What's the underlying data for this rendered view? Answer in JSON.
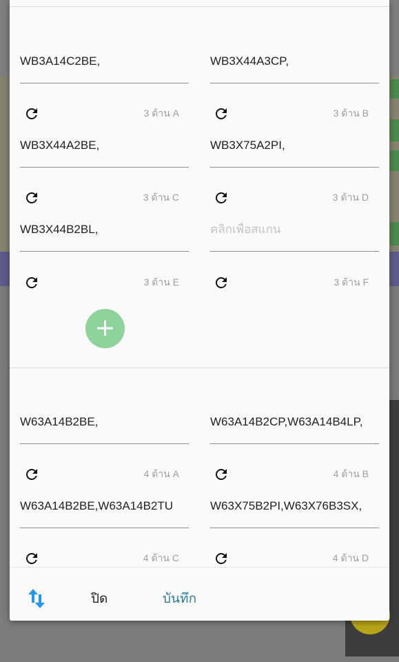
{
  "colors": {
    "accent": "#2196f3",
    "save": "#2e7d9a",
    "fab": "#8ed39c",
    "divider": "#d8d8d8"
  },
  "groups": [
    {
      "fields": [
        {
          "value": "WB3A14C2BE,",
          "label": "3 ด้าน A"
        },
        {
          "value": "WB3X44A3CP,",
          "label": "3 ด้าน B"
        },
        {
          "value": "WB3X44A2BE,",
          "label": "3 ด้าน C"
        },
        {
          "value": "WB3X75A2PI,",
          "label": "3 ด้าน D"
        },
        {
          "value": "WB3X44B2BL,",
          "label": "3 ด้าน E"
        },
        {
          "value": "",
          "placeholder": "คลิกเพื่อสแกน",
          "label": "3 ด้าน F"
        }
      ]
    },
    {
      "fields": [
        {
          "value": "W63A14B2BE,",
          "label": "4 ด้าน A"
        },
        {
          "value": "W63A14B2CP,W63A14B4LP,",
          "label": "4 ด้าน B"
        },
        {
          "value": "W63A14B2BE,W63A14B2TU",
          "label": "4 ด้าน C"
        },
        {
          "value": "W63X75B2PI,W63X76B3SX,",
          "label": "4 ด้าน D"
        }
      ]
    }
  ],
  "add_button": {
    "icon": "plus-icon"
  },
  "actions": {
    "sort_icon": "swap-vertical-icon",
    "close_label": "ปิด",
    "save_label": "บันทึก"
  }
}
